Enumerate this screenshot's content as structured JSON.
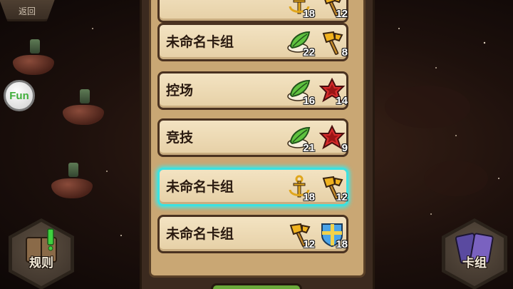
{
  "header": {
    "back_label": "返回"
  },
  "left_panel": {
    "fun_label": "Fun",
    "rules_label": "规则"
  },
  "right_panel": {
    "decks_label": "卡组"
  },
  "decks": [
    {
      "name": "",
      "icons": [
        {
          "type": "anchor-icon",
          "count": "18"
        },
        {
          "type": "axe-icon",
          "count": "12"
        }
      ],
      "selected": false
    },
    {
      "name": "未命名卡组",
      "icons": [
        {
          "type": "leaf-icon",
          "count": "22"
        },
        {
          "type": "axe-icon",
          "count": "8"
        }
      ],
      "selected": false
    },
    {
      "name": "控场",
      "icons": [
        {
          "type": "leaf-icon",
          "count": "16"
        },
        {
          "type": "star-icon",
          "count": "14"
        }
      ],
      "selected": false
    },
    {
      "name": "竞技",
      "icons": [
        {
          "type": "leaf-icon",
          "count": "21"
        },
        {
          "type": "star-icon",
          "count": "9"
        }
      ],
      "selected": false
    },
    {
      "name": "未命名卡组",
      "icons": [
        {
          "type": "anchor-icon",
          "count": "18"
        },
        {
          "type": "axe-icon",
          "count": "12"
        }
      ],
      "selected": true
    },
    {
      "name": "未命名卡组",
      "icons": [
        {
          "type": "axe-icon",
          "count": "12"
        },
        {
          "type": "shield-icon",
          "count": "18"
        }
      ],
      "selected": false
    }
  ],
  "colors": {
    "panel": "#c9a774",
    "deck": "#f3e3c2",
    "selected_glow": "#3ce1e0"
  }
}
